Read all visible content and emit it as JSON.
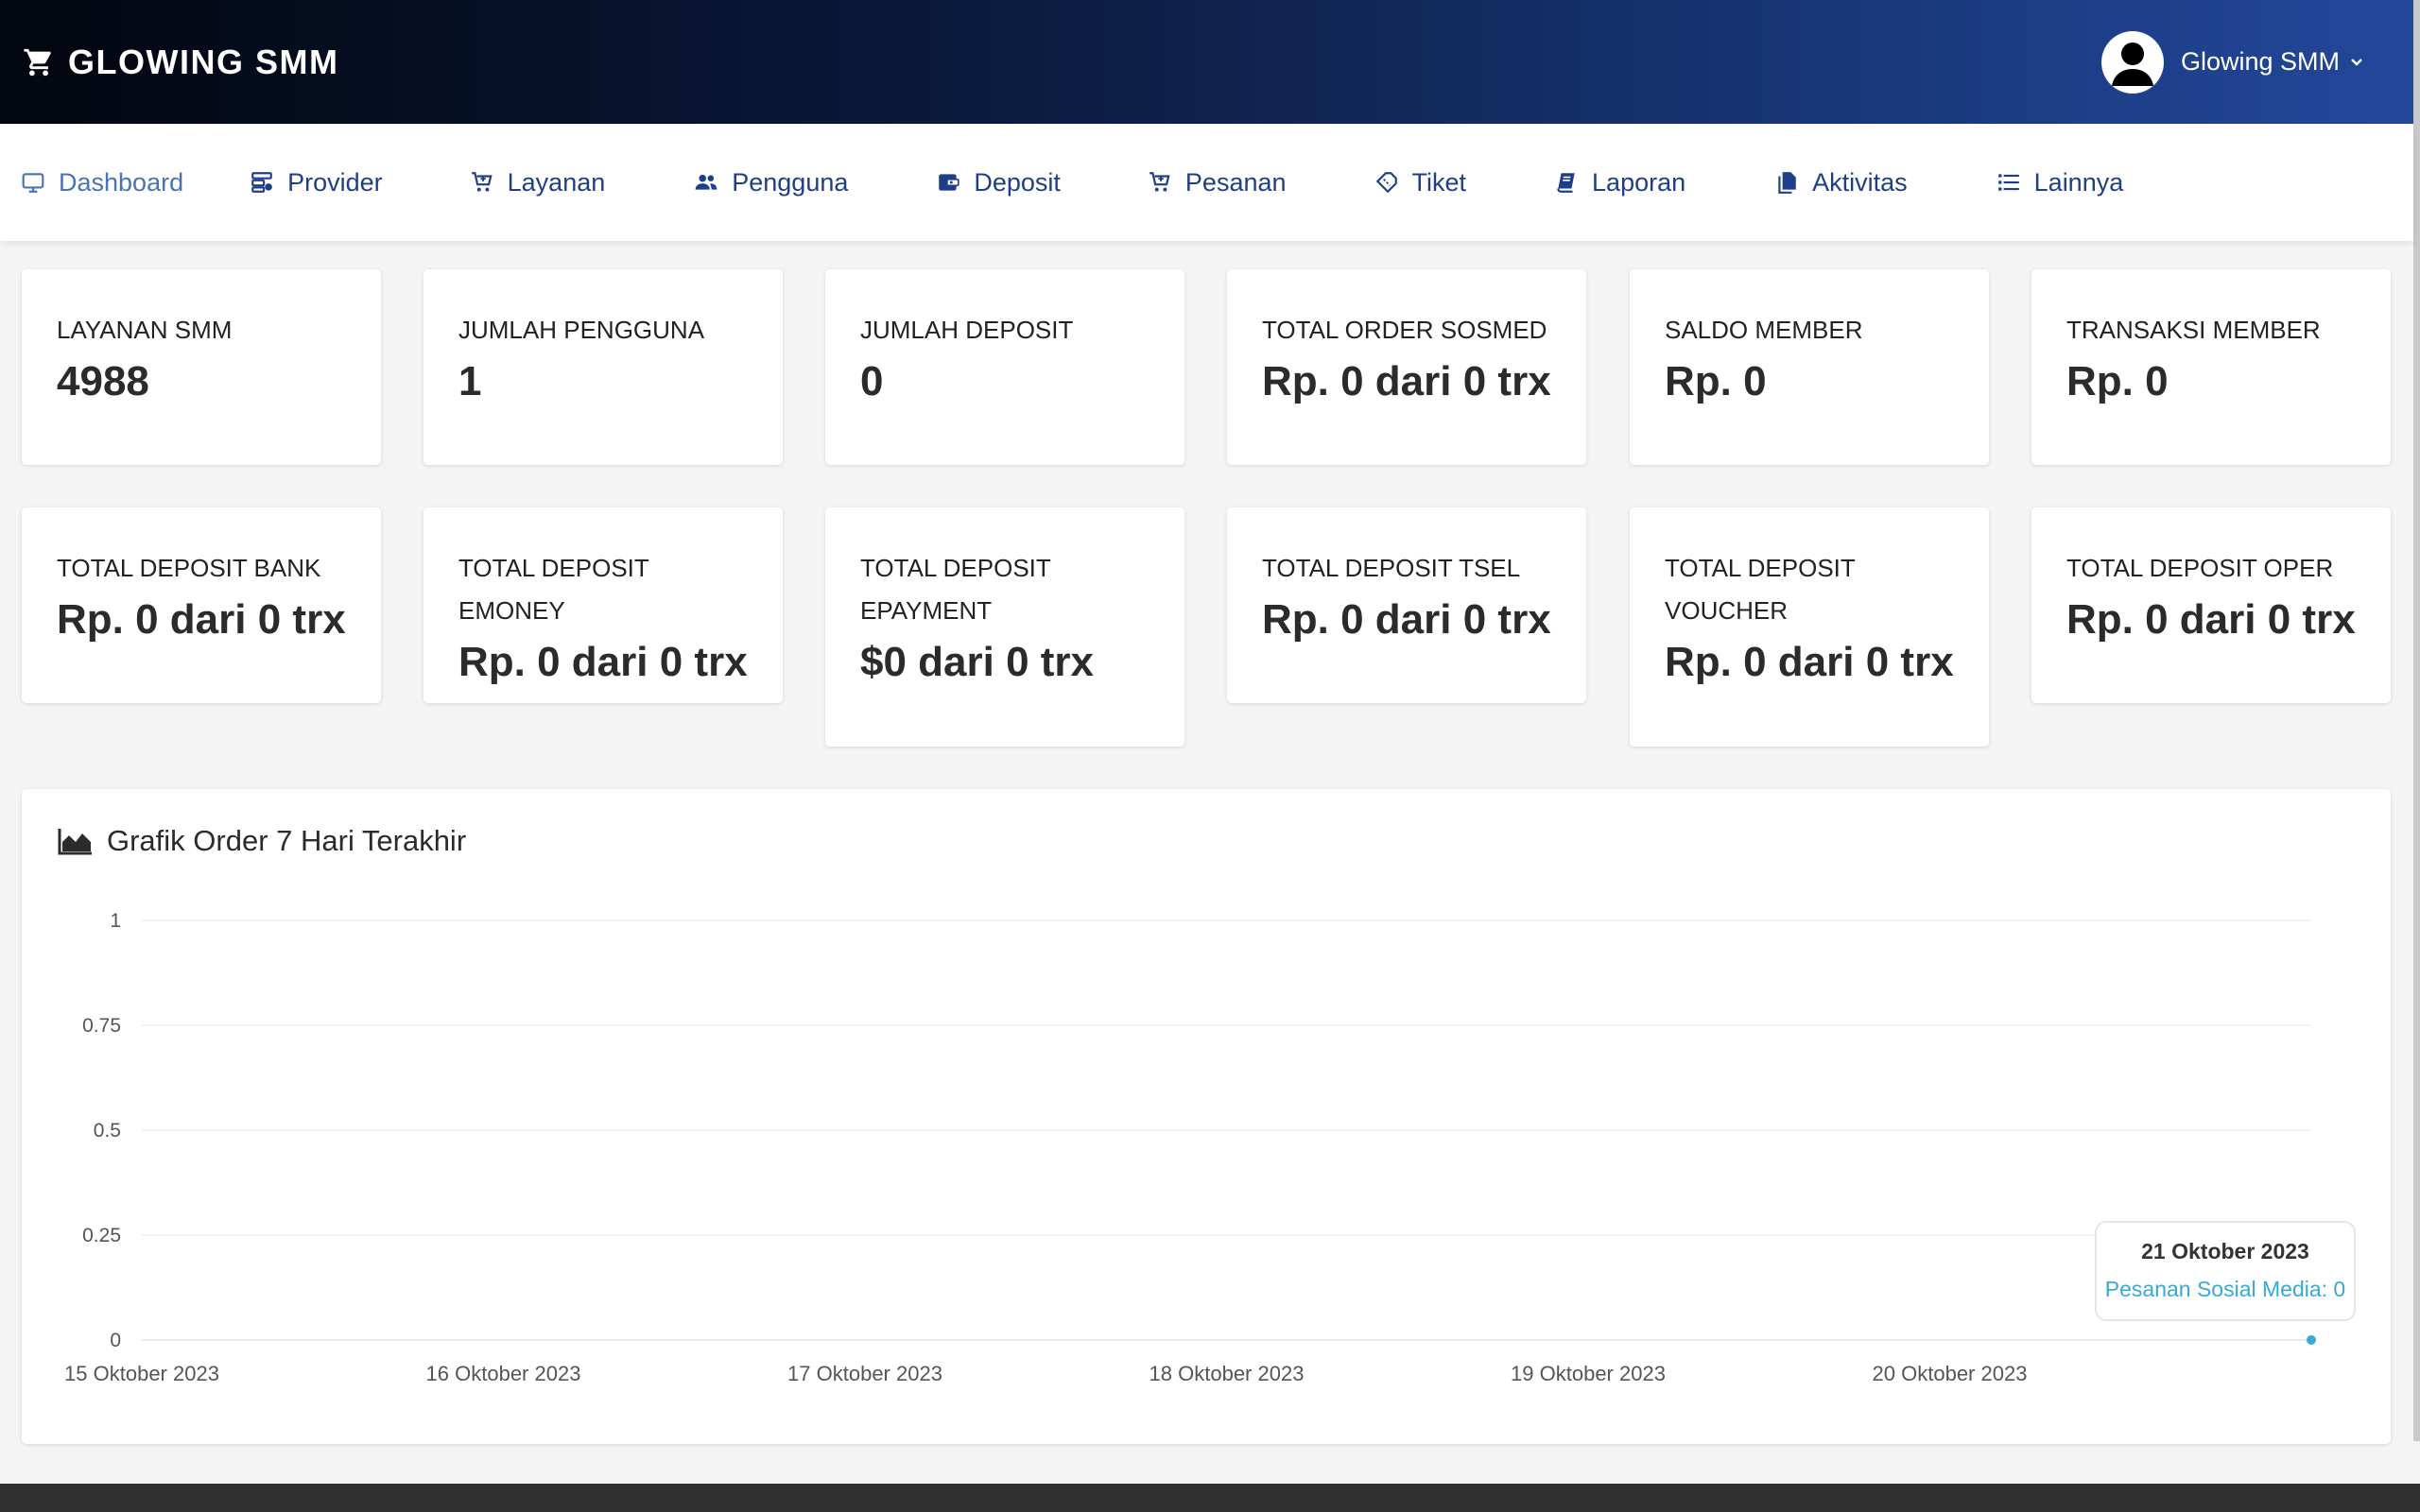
{
  "header": {
    "brand": "GLOWING SMM",
    "user_name": "Glowing SMM"
  },
  "nav": [
    {
      "label": "Dashboard",
      "icon": "monitor-icon"
    },
    {
      "label": "Provider",
      "icon": "server-icon"
    },
    {
      "label": "Layanan",
      "icon": "cart-icon"
    },
    {
      "label": "Pengguna",
      "icon": "users-icon"
    },
    {
      "label": "Deposit",
      "icon": "wallet-icon"
    },
    {
      "label": "Pesanan",
      "icon": "cart-icon"
    },
    {
      "label": "Tiket",
      "icon": "ticket-icon"
    },
    {
      "label": "Laporan",
      "icon": "book-icon"
    },
    {
      "label": "Aktivitas",
      "icon": "files-icon"
    },
    {
      "label": "Lainnya",
      "icon": "list-icon"
    }
  ],
  "stats_row1": [
    {
      "label": "LAYANAN SMM",
      "value": "4988"
    },
    {
      "label": "JUMLAH PENGGUNA",
      "value": "1"
    },
    {
      "label": "JUMLAH DEPOSIT",
      "value": "0"
    },
    {
      "label": "TOTAL ORDER SOSMED",
      "value": "Rp. 0 dari 0 trx"
    },
    {
      "label": "SALDO MEMBER",
      "value": "Rp. 0"
    },
    {
      "label": "TRANSAKSI MEMBER",
      "value": "Rp. 0"
    }
  ],
  "stats_row2": [
    {
      "label": "TOTAL DEPOSIT BANK",
      "value": "Rp. 0 dari 0 trx"
    },
    {
      "label": "TOTAL DEPOSIT EMONEY",
      "value": "Rp. 0 dari 0 trx"
    },
    {
      "label": "TOTAL DEPOSIT EPAYMENT",
      "value": "$0 dari 0 trx"
    },
    {
      "label": "TOTAL DEPOSIT TSEL",
      "value": "Rp. 0 dari 0 trx"
    },
    {
      "label": "TOTAL DEPOSIT VOUCHER",
      "value": "Rp. 0 dari 0 trx"
    },
    {
      "label": "TOTAL DEPOSIT OPER",
      "value": "Rp. 0 dari 0 trx"
    }
  ],
  "chart_panel": {
    "title": "Grafik Order 7 Hari Terakhir",
    "tooltip": {
      "date": "21 Oktober 2023",
      "text": "Pesanan Sosial Media: 0"
    }
  },
  "chart_data": {
    "type": "line",
    "title": "Grafik Order 7 Hari Terakhir",
    "x": [
      "15 Oktober 2023",
      "16 Oktober 2023",
      "17 Oktober 2023",
      "18 Oktober 2023",
      "19 Oktober 2023",
      "20 Oktober 2023",
      "21 Oktober 2023"
    ],
    "x_tick_labels": [
      "15 Oktober 2023",
      "16 Oktober 2023",
      "17 Oktober 2023",
      "18 Oktober 2023",
      "19 Oktober 2023",
      "20 Oktober 2023"
    ],
    "series": [
      {
        "name": "Pesanan Sosial Media",
        "values": [
          0,
          0,
          0,
          0,
          0,
          0,
          0
        ],
        "color": "#38a9d4"
      }
    ],
    "y_ticks": [
      "0",
      "0.25",
      "0.5",
      "0.75",
      "1"
    ],
    "ylim": [
      0,
      1
    ],
    "grid": true,
    "legend": "none",
    "highlighted_point": "21 Oktober 2023"
  },
  "colors": {
    "nav_text": "#1f3e8a",
    "nav_active": "#4a72b8",
    "series": "#38a9d4",
    "header_start": "#02060f",
    "header_end": "#23479a"
  }
}
